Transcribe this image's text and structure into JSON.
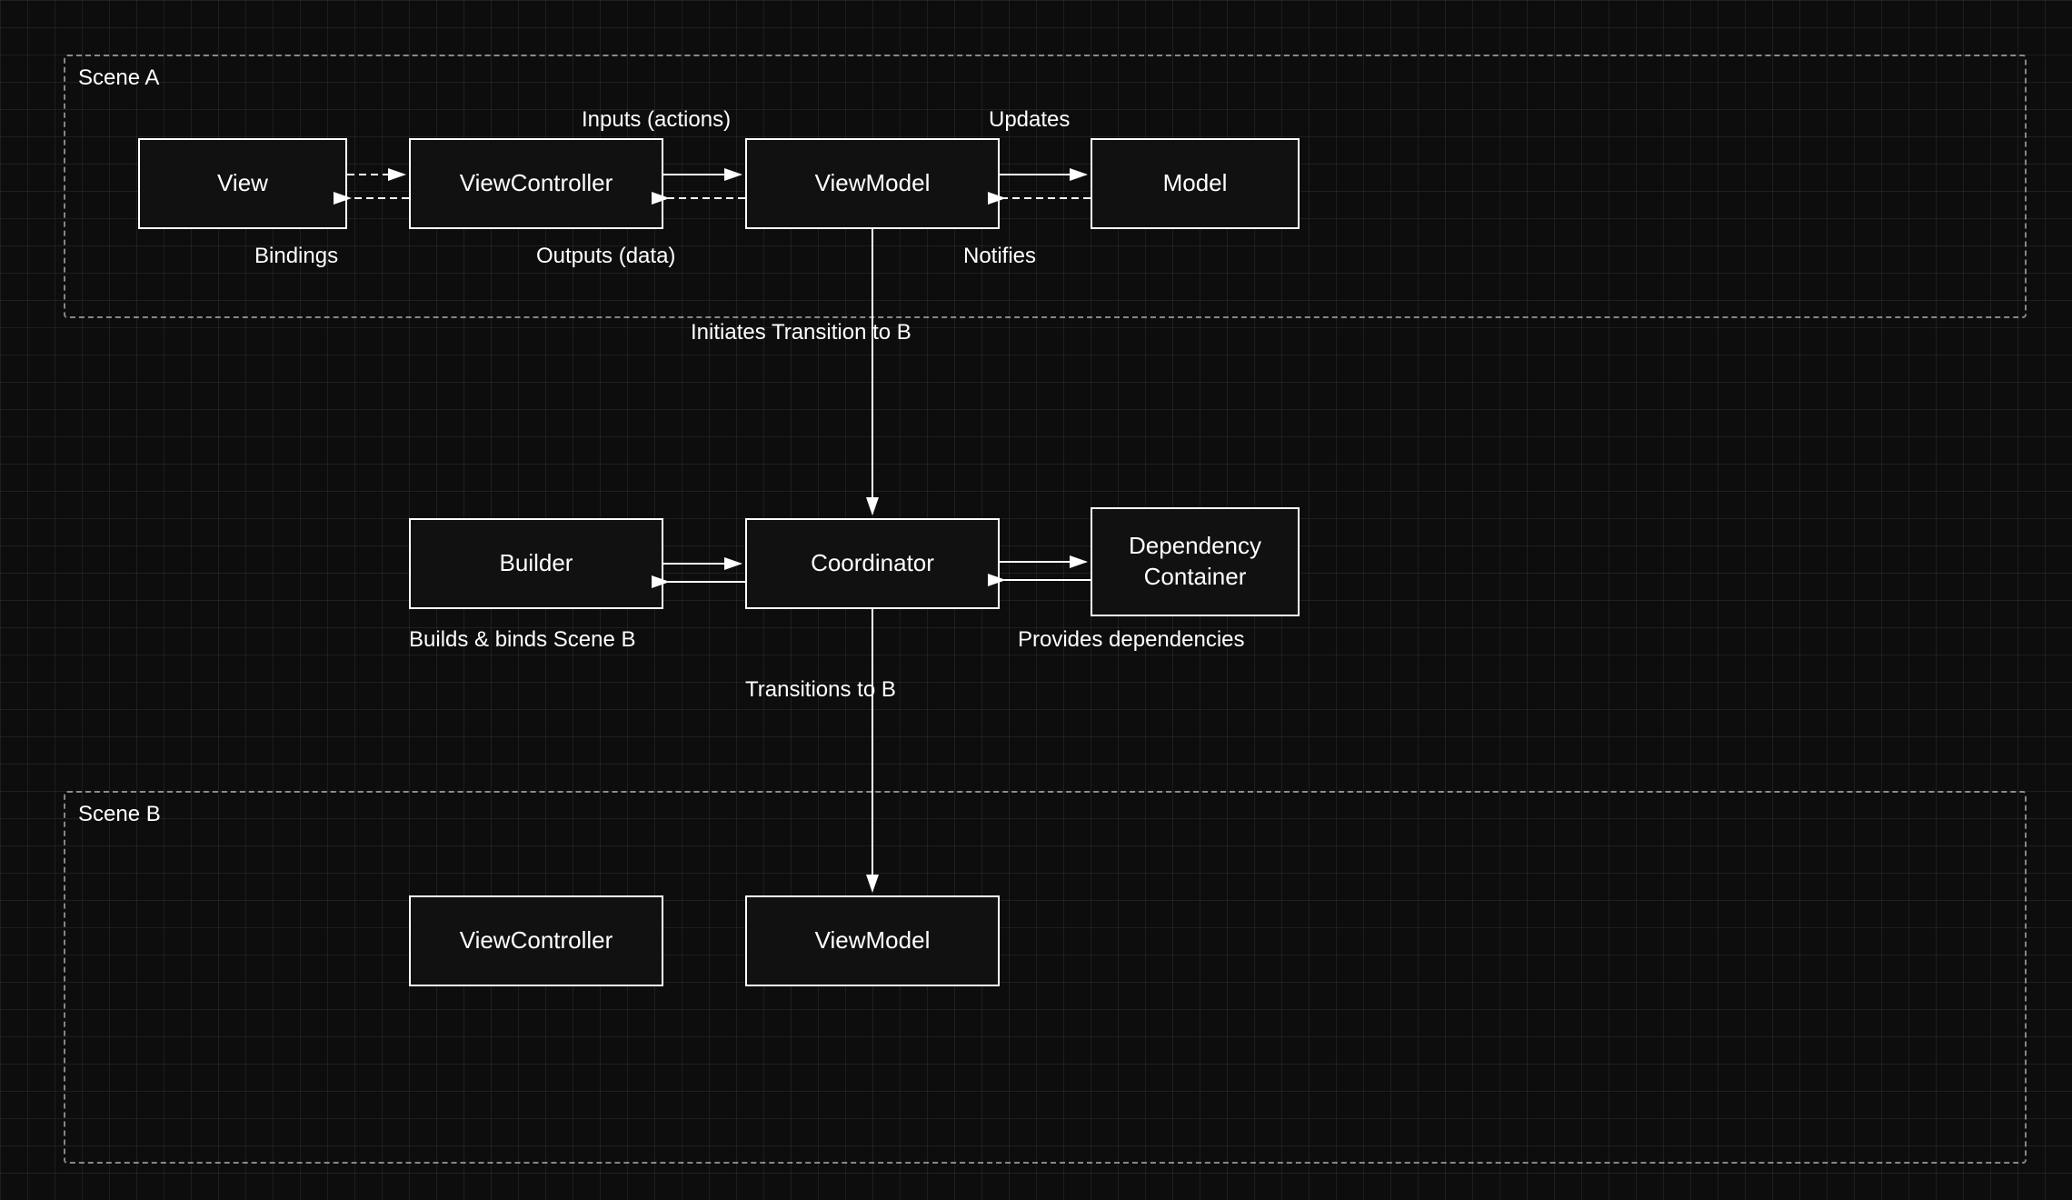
{
  "scenes": [
    {
      "id": "scene-a",
      "label": "Scene A"
    },
    {
      "id": "scene-b",
      "label": "Scene B"
    }
  ],
  "nodes": [
    {
      "id": "view",
      "label": "View"
    },
    {
      "id": "viewcontroller",
      "label": "ViewController"
    },
    {
      "id": "viewmodel",
      "label": "ViewModel"
    },
    {
      "id": "model",
      "label": "Model"
    },
    {
      "id": "builder",
      "label": "Builder"
    },
    {
      "id": "coordinator",
      "label": "Coordinator"
    },
    {
      "id": "dependency-container",
      "label": "Dependency\nContainer"
    },
    {
      "id": "viewcontroller-b",
      "label": "ViewController"
    },
    {
      "id": "viewmodel-b",
      "label": "ViewModel"
    }
  ],
  "labels": [
    {
      "id": "inputs-label",
      "text": "Inputs (actions)"
    },
    {
      "id": "updates-label",
      "text": "Updates"
    },
    {
      "id": "bindings-label",
      "text": "Bindings"
    },
    {
      "id": "outputs-label",
      "text": "Outputs (data)"
    },
    {
      "id": "notifies-label",
      "text": "Notifies"
    },
    {
      "id": "initiates-label",
      "text": "Initiates Transition to B"
    },
    {
      "id": "builds-label",
      "text": "Builds & binds Scene B"
    },
    {
      "id": "provides-label",
      "text": "Provides dependencies"
    },
    {
      "id": "transitions-label",
      "text": "Transitions to B"
    }
  ]
}
